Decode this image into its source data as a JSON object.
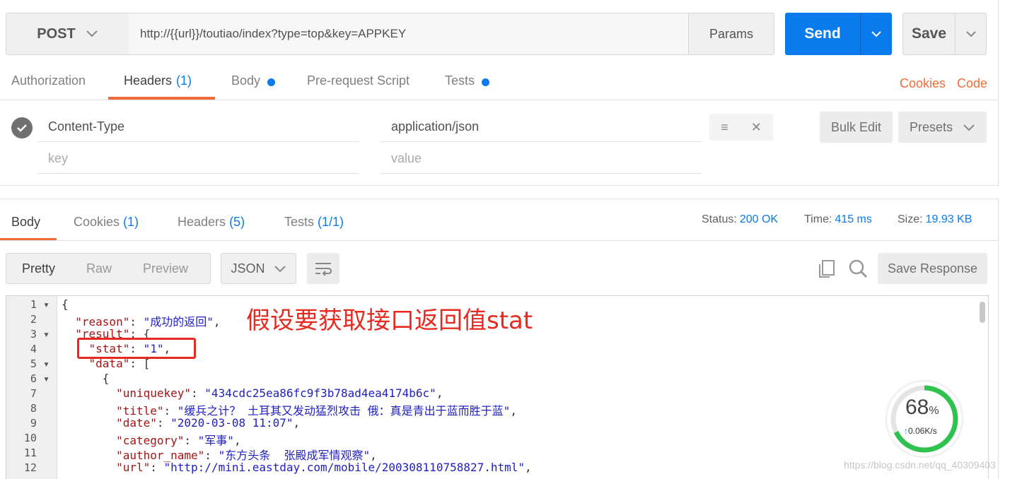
{
  "request": {
    "method": "POST",
    "url": "http://{{url}}/toutiao/index?type=top&key=APPKEY",
    "params_label": "Params",
    "send_label": "Send",
    "save_label": "Save"
  },
  "request_tabs": {
    "authorization": "Authorization",
    "headers": "Headers",
    "headers_count": "(1)",
    "body": "Body",
    "prerequest": "Pre-request Script",
    "tests": "Tests",
    "cookies": "Cookies",
    "code": "Code"
  },
  "headers_table": {
    "row_key": "Content-Type",
    "row_value": "application/json",
    "key_placeholder": "key",
    "value_placeholder": "value",
    "bulk_edit": "Bulk Edit",
    "presets": "Presets"
  },
  "response_tabs": {
    "body": "Body",
    "cookies": "Cookies",
    "cookies_count": "(1)",
    "headers": "Headers",
    "headers_count": "(5)",
    "tests": "Tests",
    "tests_count": "(1/1)"
  },
  "response_meta": {
    "status_label": "Status:",
    "status_value": "200 OK",
    "time_label": "Time:",
    "time_value": "415 ms",
    "size_label": "Size:",
    "size_value": "19.93 KB"
  },
  "view": {
    "pretty": "Pretty",
    "raw": "Raw",
    "preview": "Preview",
    "format": "JSON",
    "save_response": "Save Response"
  },
  "code_lines": {
    "l1": "{",
    "l2k": "\"reason\"",
    "l2v": "\"成功的返回\"",
    "l3k": "\"result\"",
    "l3v": "{",
    "l4k": "\"stat\"",
    "l4v": "\"1\"",
    "l5k": "\"data\"",
    "l5v": "[",
    "l6": "{",
    "l7k": "\"uniquekey\"",
    "l7v": "\"434cdc25ea86fc9f3b78ad4ea4174b6c\"",
    "l8k": "\"title\"",
    "l8v": "\"缓兵之计？ 土耳其又发动猛烈攻击 俄：真是青出于蓝而胜于蓝\"",
    "l9k": "\"date\"",
    "l9v": "\"2020-03-08 11:07\"",
    "l10k": "\"category\"",
    "l10v": "\"军事\"",
    "l11k": "\"author_name\"",
    "l11v": "\"东方头条  张殿成军情观察\"",
    "l12k": "\"url\"",
    "l12v": "\"http://mini.eastday.com/mobile/200308110758827.html\""
  },
  "annotation": "假设要获取接口返回值stat",
  "speed_widget": {
    "percent": "68",
    "percent_sign": "%",
    "rate": "0.06K/s",
    "level": 0.68
  },
  "watermark": "https://blog.csdn.net/qq_40309403"
}
